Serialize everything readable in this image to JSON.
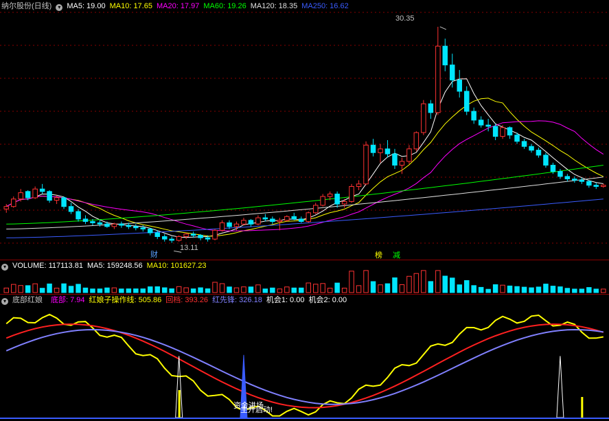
{
  "price_pane": {
    "title": "纳尔股份(日线)",
    "ma_items": [
      {
        "label": "MA5: 19.00",
        "color": "#ffffff"
      },
      {
        "label": "MA10: 17.65",
        "color": "#ffff00"
      },
      {
        "label": "MA20: 17.97",
        "color": "#ff00ff"
      },
      {
        "label": "MA60: 19.26",
        "color": "#00ff00"
      },
      {
        "label": "MA120: 18.35",
        "color": "#e0e0e0"
      },
      {
        "label": "MA250: 16.62",
        "color": "#3a5cff"
      }
    ],
    "high_label": "30.35",
    "low_label": "13.11",
    "markers": [
      {
        "text": "财",
        "color": "#5aa0ff"
      },
      {
        "text": "榜",
        "color": "#ffff00"
      },
      {
        "text": "减",
        "color": "#00ff00"
      }
    ]
  },
  "volume_pane": {
    "items": [
      {
        "label": "VOLUME: 117113.81",
        "color": "#ffffff"
      },
      {
        "label": "MA5: 159248.56",
        "color": "#ffffff"
      },
      {
        "label": "MA10: 101627.23",
        "color": "#ffff00"
      }
    ]
  },
  "indicator_pane": {
    "name": "底部红娘",
    "items": [
      {
        "label": "底部: 7.94",
        "color": "#ff00ff"
      },
      {
        "label": "红娘子操作线: 505.86",
        "color": "#ffff00"
      },
      {
        "label": "回档: 393.26",
        "color": "#ff3030"
      },
      {
        "label": "红先锋: 326.18",
        "color": "#8080ff"
      },
      {
        "label": "机会1: 0.00",
        "color": "#ffffff"
      },
      {
        "label": "机会2: 0.00",
        "color": "#ffffff"
      }
    ],
    "annotations": [
      {
        "text": "资金进场"
      },
      {
        "text": "主升启动!"
      }
    ]
  },
  "chart_data": {
    "type": "candlestick",
    "colors": {
      "up": "#ff3232",
      "down": "#00e5ff",
      "grid": "#8a0000"
    },
    "ylim": [
      12.2,
      31.5
    ],
    "candles": [
      [
        15.8,
        16.2,
        15.5,
        16.0
      ],
      [
        16.0,
        16.8,
        15.9,
        16.6
      ],
      [
        16.6,
        17.4,
        16.4,
        17.1
      ],
      [
        17.2,
        17.3,
        16.5,
        16.7
      ],
      [
        16.7,
        17.6,
        16.6,
        17.4
      ],
      [
        17.4,
        17.8,
        17.0,
        17.2
      ],
      [
        17.2,
        17.3,
        16.3,
        16.5
      ],
      [
        16.5,
        16.9,
        16.2,
        16.7
      ],
      [
        16.7,
        16.8,
        15.8,
        16.0
      ],
      [
        16.0,
        16.3,
        15.4,
        15.6
      ],
      [
        15.6,
        15.8,
        14.8,
        15.0
      ],
      [
        15.0,
        15.3,
        14.6,
        14.8
      ],
      [
        14.8,
        15.0,
        14.5,
        14.7
      ],
      [
        14.7,
        14.9,
        14.4,
        14.6
      ],
      [
        14.6,
        14.8,
        14.3,
        14.4
      ],
      [
        14.4,
        14.7,
        14.2,
        14.6
      ],
      [
        14.6,
        14.8,
        14.3,
        14.5
      ],
      [
        14.5,
        14.7,
        14.2,
        14.4
      ],
      [
        14.4,
        14.6,
        14.1,
        14.3
      ],
      [
        14.3,
        14.5,
        14.0,
        14.2
      ],
      [
        14.2,
        14.3,
        13.7,
        13.9
      ],
      [
        13.9,
        14.1,
        13.4,
        13.6
      ],
      [
        13.6,
        13.8,
        13.2,
        13.4
      ],
      [
        13.4,
        13.6,
        13.1,
        13.3
      ],
      [
        13.3,
        13.7,
        13.2,
        13.6
      ],
      [
        13.6,
        13.9,
        13.4,
        13.8
      ],
      [
        13.8,
        14.0,
        13.5,
        13.7
      ],
      [
        13.7,
        13.8,
        13.3,
        13.5
      ],
      [
        13.5,
        13.7,
        13.2,
        13.4
      ],
      [
        13.4,
        14.2,
        13.3,
        14.1
      ],
      [
        14.1,
        14.9,
        14.0,
        14.7
      ],
      [
        14.7,
        14.9,
        14.2,
        14.4
      ],
      [
        14.4,
        14.8,
        14.1,
        14.6
      ],
      [
        14.6,
        15.1,
        14.5,
        14.9
      ],
      [
        14.9,
        15.0,
        14.4,
        14.6
      ],
      [
        14.6,
        15.3,
        14.5,
        15.1
      ],
      [
        15.1,
        15.4,
        14.8,
        15.0
      ],
      [
        15.0,
        15.2,
        14.6,
        14.8
      ],
      [
        14.8,
        15.1,
        14.1,
        14.9
      ],
      [
        14.9,
        15.3,
        14.8,
        15.2
      ],
      [
        15.2,
        15.5,
        14.9,
        15.0
      ],
      [
        15.0,
        15.2,
        14.7,
        14.8
      ],
      [
        14.8,
        15.6,
        14.7,
        15.5
      ],
      [
        15.5,
        16.3,
        15.4,
        16.1
      ],
      [
        16.1,
        17.0,
        16.0,
        16.8
      ],
      [
        16.8,
        17.2,
        16.5,
        17.0
      ],
      [
        17.0,
        17.2,
        15.9,
        16.2
      ],
      [
        16.2,
        16.6,
        15.9,
        16.4
      ],
      [
        16.4,
        17.8,
        16.3,
        17.6
      ],
      [
        17.6,
        18.1,
        17.3,
        17.8
      ],
      [
        17.8,
        21.2,
        17.7,
        20.9
      ],
      [
        20.9,
        21.4,
        20.0,
        20.3
      ],
      [
        20.3,
        21.0,
        19.5,
        20.6
      ],
      [
        20.6,
        21.3,
        19.9,
        20.2
      ],
      [
        20.2,
        20.6,
        19.0,
        19.3
      ],
      [
        19.3,
        19.9,
        18.6,
        19.6
      ],
      [
        19.6,
        20.9,
        19.4,
        20.6
      ],
      [
        20.6,
        22.0,
        20.4,
        21.9
      ],
      [
        21.9,
        24.5,
        21.7,
        24.2
      ],
      [
        24.2,
        24.5,
        23.0,
        23.5
      ],
      [
        23.5,
        30.35,
        23.3,
        28.8
      ],
      [
        28.8,
        29.4,
        26.8,
        27.3
      ],
      [
        27.3,
        28.2,
        25.5,
        26.1
      ],
      [
        26.1,
        26.9,
        24.7,
        25.2
      ],
      [
        25.2,
        25.6,
        23.3,
        23.6
      ],
      [
        23.6,
        23.9,
        22.6,
        22.9
      ],
      [
        22.9,
        23.2,
        22.3,
        22.5
      ],
      [
        22.5,
        23.0,
        22.0,
        22.4
      ],
      [
        22.4,
        22.6,
        21.3,
        21.6
      ],
      [
        21.6,
        22.5,
        21.4,
        22.3
      ],
      [
        22.3,
        22.4,
        21.4,
        21.7
      ],
      [
        21.7,
        21.9,
        21.0,
        21.2
      ],
      [
        21.2,
        21.4,
        20.6,
        20.8
      ],
      [
        20.8,
        21.0,
        20.3,
        20.5
      ],
      [
        20.5,
        20.7,
        19.9,
        20.1
      ],
      [
        20.1,
        20.3,
        19.1,
        19.3
      ],
      [
        19.3,
        19.5,
        18.6,
        18.8
      ],
      [
        18.8,
        19.0,
        18.2,
        18.4
      ],
      [
        18.4,
        18.6,
        18.0,
        18.2
      ],
      [
        18.2,
        18.4,
        17.9,
        18.1
      ],
      [
        18.1,
        18.3,
        17.8,
        18.0
      ],
      [
        18.0,
        18.1,
        17.5,
        17.7
      ],
      [
        17.7,
        17.9,
        17.4,
        17.6
      ],
      [
        17.6,
        17.8,
        17.5,
        17.7
      ]
    ],
    "volume_ylim": [
      0,
      350000
    ],
    "indicator_ylim": [
      0,
      1000
    ]
  }
}
